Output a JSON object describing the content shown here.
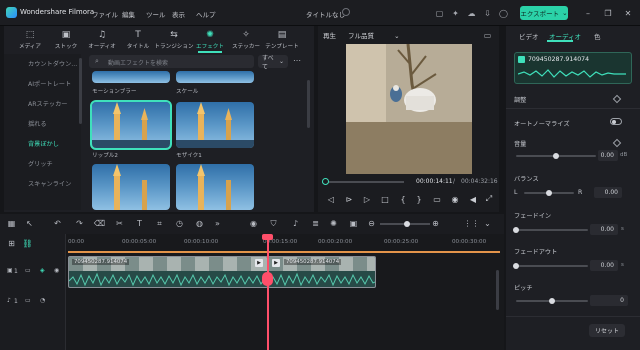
{
  "app": {
    "name": "Wondershare Filmora",
    "project_title": "タイトルなし",
    "export_label": "エクスポート"
  },
  "menu": [
    "ファイル",
    "編集",
    "ツール",
    "表示",
    "ヘルプ"
  ],
  "categories": [
    {
      "label": "メディア",
      "icon": "media-icon"
    },
    {
      "label": "ストック",
      "icon": "stock-icon"
    },
    {
      "label": "オーディオ",
      "icon": "music-note-icon"
    },
    {
      "label": "タイトル",
      "icon": "text-icon"
    },
    {
      "label": "トランジション",
      "icon": "transition-icon"
    },
    {
      "label": "エフェクト",
      "icon": "sparkle-icon"
    },
    {
      "label": "ステッカー",
      "icon": "sticker-icon"
    },
    {
      "label": "テンプレート",
      "icon": "template-icon"
    }
  ],
  "active_category": "エフェクト",
  "sidebar": [
    "カウントダウン...",
    "AIポートレート",
    "ARステッカー",
    "揺れる",
    "背景ぼかし",
    "グリッチ",
    "スキャンライン"
  ],
  "sidebar_active": "背景ぼかし",
  "search": {
    "placeholder": "動画エフェクトを検索"
  },
  "filter": {
    "value": "すべて"
  },
  "effects": [
    "モーションブラー",
    "スケール",
    "リップル2",
    "モザイク1",
    "",
    ""
  ],
  "selected_effect": "リップル2",
  "player": {
    "tab_play": "再生",
    "quality": "フル品質",
    "current_time": "00:00:14:11",
    "separator": "/",
    "total_time": "00:04:32:16",
    "progress": 0.04
  },
  "right_panel": {
    "tabs": [
      "ビデオ",
      "オーディオ",
      "色"
    ],
    "active_tab": "オーディオ",
    "audio_file": "709450287.914074",
    "section": "調整",
    "auto_normalize": {
      "label": "オートノーマライズ",
      "enabled": false
    },
    "volume": {
      "label": "音量",
      "value": "0.00",
      "unit": "dB",
      "level": 0.5
    },
    "balance": {
      "label": "バランス",
      "left": "L",
      "right": "R",
      "value": "0.00",
      "level": 0.5
    },
    "fade_in": {
      "label": "フェードイン",
      "value": "0.00",
      "unit": "s",
      "level": 0.0
    },
    "fade_out": {
      "label": "フェードアウト",
      "value": "0.00",
      "unit": "s",
      "level": 0.0
    },
    "pitch": {
      "label": "ピッチ",
      "value": "0",
      "level": 0.5
    },
    "reset_label": "リセット"
  },
  "timeline": {
    "ruler": [
      "00:00",
      "00:00:05:00",
      "00:00:10:00",
      "00:00:15:00",
      "00:00:20:00",
      "00:00:25:00",
      "00:00:30:00"
    ],
    "clip1_name": "709450287.914074",
    "clip2_name": "709450287.914074",
    "tracks": [
      {
        "number": "1",
        "type": "video"
      },
      {
        "number": "1",
        "type": "audio"
      }
    ]
  },
  "colors": {
    "accent": "#3fe0bb",
    "playhead": "#ff4f6a",
    "export": "#2bd2a8"
  }
}
